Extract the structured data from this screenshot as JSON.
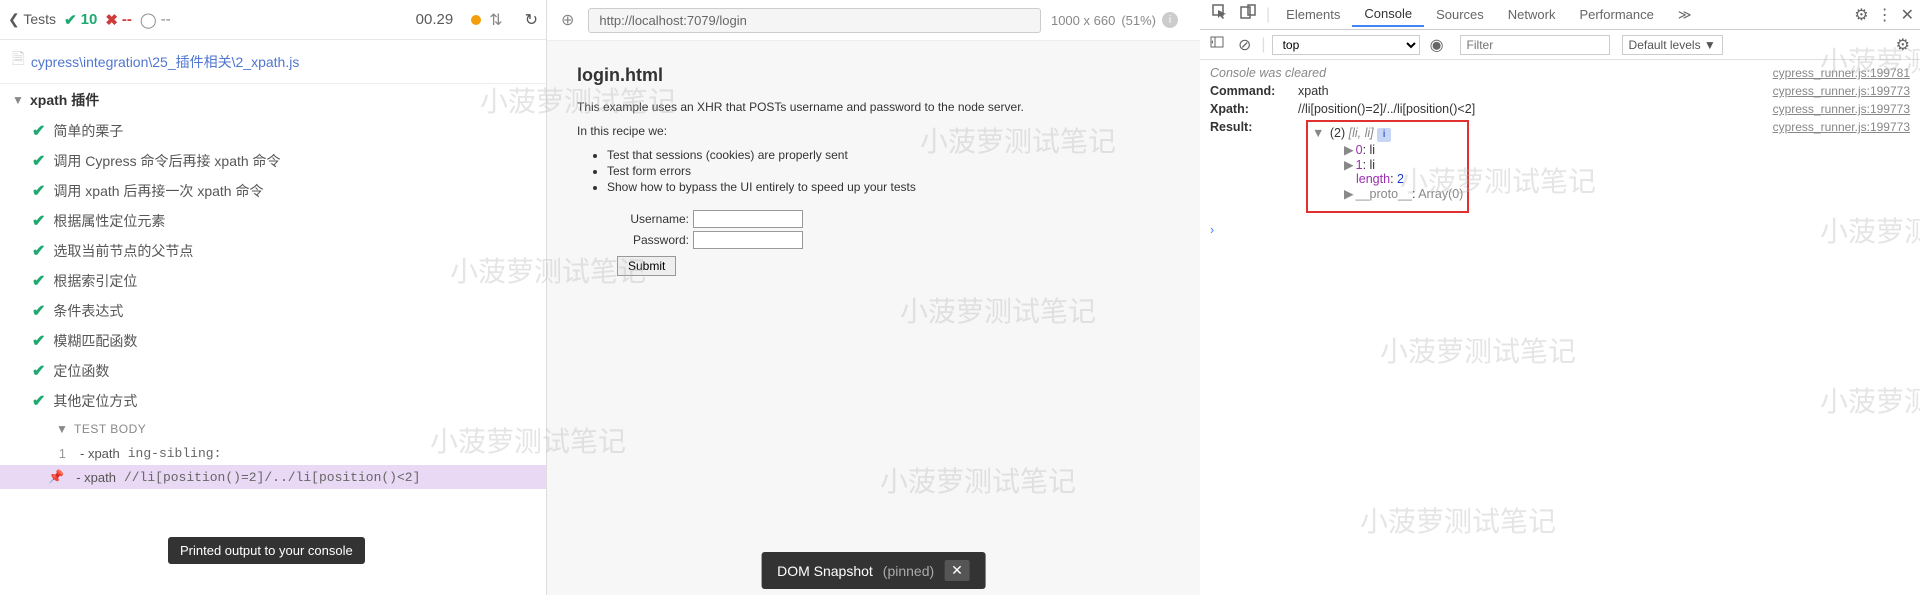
{
  "header": {
    "tests_label": "Tests",
    "pass_count": "10",
    "fail_count": "--",
    "pending": "--",
    "duration": "00.29"
  },
  "file_path": "cypress\\integration\\25_插件相关\\2_xpath.js",
  "suite": {
    "title": "xpath 插件",
    "tests": [
      "简单的栗子",
      "调用 Cypress 命令后再接 xpath 命令",
      "调用 xpath 后再接一次 xpath 命令",
      "根据属性定位元素",
      "选取当前节点的父节点",
      "根据索引定位",
      "条件表达式",
      "模糊匹配函数",
      "定位函数",
      "其他定位方式"
    ]
  },
  "test_body_label": "TEST BODY",
  "commands": [
    {
      "num": "1",
      "name": "- xpath",
      "msg": "ing-sibling:"
    },
    {
      "num": "",
      "name": "- xpath",
      "msg": "//li[position()=2]/../li[position()<2]"
    }
  ],
  "tooltip_text": "Printed output to your console",
  "url_bar": {
    "url": "http://localhost:7079/login",
    "dimensions": "1000 x 660",
    "scale": "(51%)"
  },
  "preview": {
    "title": "login.html",
    "desc": "This example uses an XHR that POSTs username and password to the node server.",
    "recipe_intro": "In this recipe we:",
    "bullets": [
      "Test that sessions (cookies) are properly sent",
      "Test form errors",
      "Show how to bypass the UI entirely to speed up your tests"
    ],
    "username_label": "Username:",
    "password_label": "Password:",
    "submit_label": "Submit"
  },
  "snapshot": {
    "label": "DOM Snapshot",
    "state": "(pinned)"
  },
  "devtools": {
    "tabs": [
      "Elements",
      "Console",
      "Sources",
      "Network",
      "Performance"
    ],
    "context": "top",
    "filter_placeholder": "Filter",
    "levels": "Default levels ▼"
  },
  "console": {
    "cleared": "Console was cleared",
    "command_label": "Command:",
    "command_val": "xpath",
    "xpath_label": "Xpath:",
    "xpath_val": "//li[position()=2]/../li[position()<2]",
    "result_label": "Result:",
    "array_len": "(2)",
    "array_content": "[li, li]",
    "items": [
      {
        "key": "0",
        "val": "li"
      },
      {
        "key": "1",
        "val": "li"
      }
    ],
    "length_key": "length",
    "length_val": "2",
    "proto_key": "__proto__",
    "proto_val": "Array(0)",
    "sources": [
      "cypress_runner.js:199781",
      "cypress_runner.js:199773",
      "cypress_runner.js:199773",
      "cypress_runner.js:199773"
    ]
  },
  "watermark_text": "小菠萝测试笔记"
}
